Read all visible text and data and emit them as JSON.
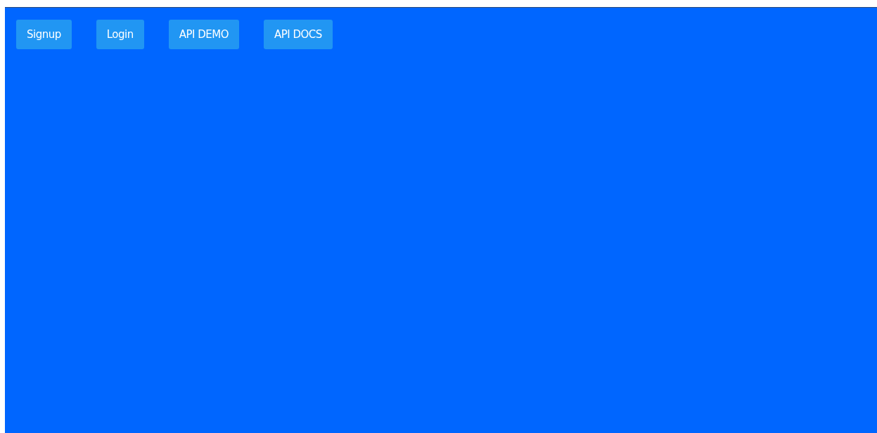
{
  "nav": {
    "buttons": [
      {
        "label": "Signup"
      },
      {
        "label": "Login"
      },
      {
        "label": "API DEMO"
      },
      {
        "label": "API DOCS"
      }
    ]
  }
}
